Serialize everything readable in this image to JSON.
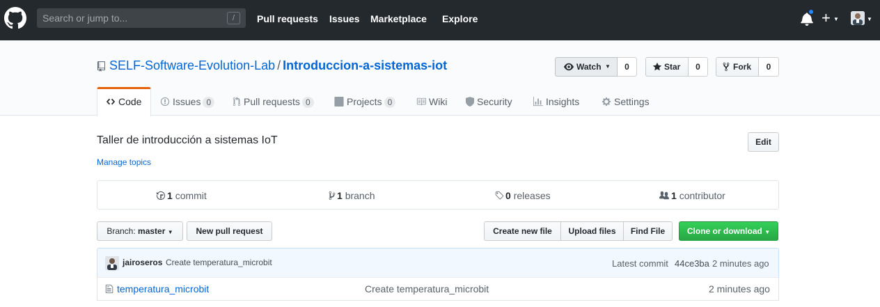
{
  "header": {
    "search_placeholder": "Search or jump to...",
    "search_shortcut": "/",
    "nav": [
      "Pull requests",
      "Issues",
      "Marketplace",
      "Explore"
    ],
    "plus_label": "+",
    "notification_dot_color": "#2188ff"
  },
  "repo": {
    "owner": "SELF-Software-Evolution-Lab",
    "separator": "/",
    "name": "Introduccion-a-sistemas-iot",
    "watch_label": "Watch",
    "watch_count": "0",
    "star_label": "Star",
    "star_count": "0",
    "fork_label": "Fork",
    "fork_count": "0"
  },
  "tabs": {
    "code": "Code",
    "issues": "Issues",
    "issues_count": "0",
    "pulls": "Pull requests",
    "pulls_count": "0",
    "projects": "Projects",
    "projects_count": "0",
    "wiki": "Wiki",
    "security": "Security",
    "insights": "Insights",
    "settings": "Settings"
  },
  "about": {
    "description": "Taller de introducción a sistemas IoT",
    "manage_topics": "Manage topics",
    "edit_label": "Edit"
  },
  "summary": {
    "commits_num": "1",
    "commits_label": "commit",
    "branches_num": "1",
    "branches_label": "branch",
    "releases_num": "0",
    "releases_label": "releases",
    "contributors_num": "1",
    "contributors_label": "contributor"
  },
  "file_nav": {
    "branch_prefix": "Branch:",
    "branch_name": "master",
    "new_pr": "New pull request",
    "create_file": "Create new file",
    "upload": "Upload files",
    "find": "Find File",
    "clone": "Clone or download"
  },
  "latest_commit": {
    "author": "jairoseros",
    "message": "Create temperatura_microbit",
    "label": "Latest commit",
    "sha": "44ce3ba",
    "time": "2 minutes ago"
  },
  "files": [
    {
      "name": "temperatura_microbit",
      "message": "Create temperatura_microbit",
      "age": "2 minutes ago"
    }
  ]
}
